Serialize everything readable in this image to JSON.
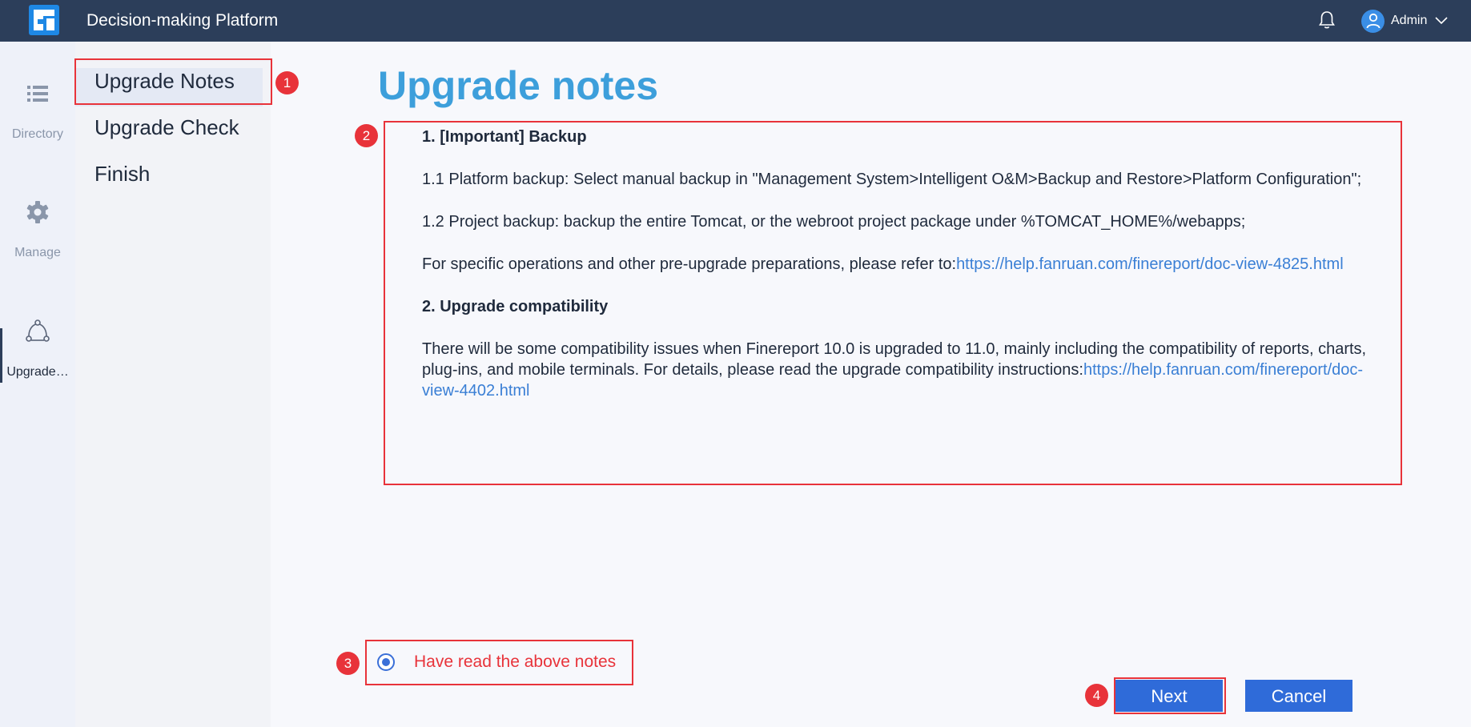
{
  "header": {
    "app_title": "Decision-making Platform",
    "user_name": "Admin",
    "bg_color": "#2c3e5a"
  },
  "rail": {
    "items": [
      {
        "label": "Directory",
        "icon": "list-icon"
      },
      {
        "label": "Manage",
        "icon": "gear-icon"
      },
      {
        "label": "Upgrade…",
        "icon": "upgrade-icon",
        "active": true
      }
    ]
  },
  "steps": {
    "items": [
      {
        "label": "Upgrade Notes",
        "active": true
      },
      {
        "label": "Upgrade Check"
      },
      {
        "label": "Finish"
      }
    ]
  },
  "main": {
    "title": "Upgrade notes",
    "notes": {
      "backup_heading": "1. [Important] Backup",
      "platform_backup": "1.1 Platform backup: Select manual backup in \"Management System>Intelligent O&M>Backup and Restore>Platform Configuration\";",
      "project_backup": "1.2 Project backup: backup the entire Tomcat, or the webroot project package under %TOMCAT_HOME%/webapps;",
      "refer_text": "For specific operations and other pre-upgrade preparations, please refer to:",
      "refer_link": "https://help.fanruan.com/finereport/doc-view-4825.html",
      "compat_heading": "2. Upgrade compatibility",
      "compat_text": "There will be some compatibility issues when Finereport 10.0 is upgraded to 11.0, mainly including the compatibility of reports, charts, plug-ins, and mobile terminals. For details, please read the upgrade compatibility instructions:",
      "compat_link": "https://help.fanruan.com/finereport/doc-view-4402.html"
    },
    "confirm_label": "Have read the above notes",
    "confirm_checked": true
  },
  "buttons": {
    "next_label": "Next",
    "cancel_label": "Cancel"
  },
  "markers": [
    "1",
    "2",
    "3",
    "4"
  ],
  "colors": {
    "accent": "#2f6bd9",
    "title": "#3d9fdb",
    "annotation": "#e8333a",
    "link": "#3a7fd5"
  }
}
